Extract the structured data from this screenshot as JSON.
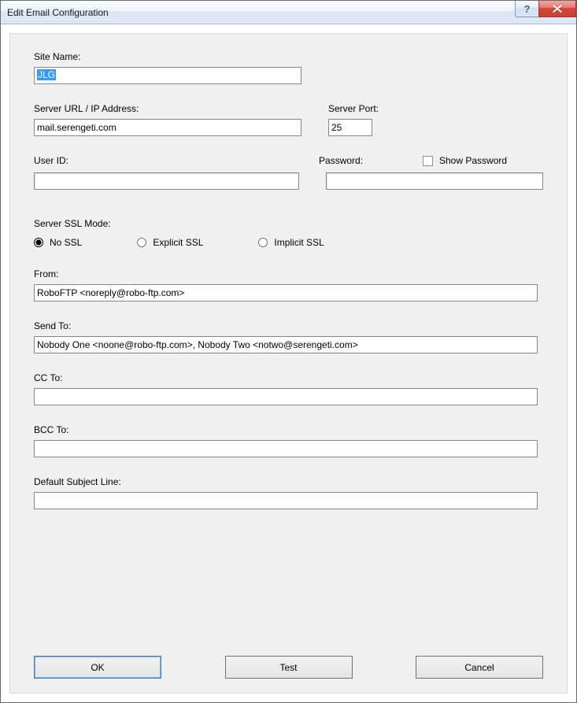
{
  "titlebar": {
    "title": "Edit Email Configuration"
  },
  "fields": {
    "site_name": {
      "label": "Site Name:",
      "value": "JLG"
    },
    "server_url": {
      "label": "Server URL / IP Address:",
      "value": "mail.serengeti.com"
    },
    "server_port": {
      "label": "Server Port:",
      "value": "25"
    },
    "user_id": {
      "label": "User ID:",
      "value": ""
    },
    "password": {
      "label": "Password:",
      "value": ""
    },
    "show_password": {
      "label": "Show Password",
      "checked": false
    },
    "ssl_mode": {
      "label": "Server SSL Mode:",
      "options": {
        "none": "No SSL",
        "explicit": "Explicit SSL",
        "implicit": "Implicit SSL"
      },
      "selected": "none"
    },
    "from": {
      "label": "From:",
      "value": "RoboFTP <noreply@robo-ftp.com>"
    },
    "send_to": {
      "label": "Send To:",
      "value": "Nobody One <noone@robo-ftp.com>, Nobody Two <notwo@serengeti.com>"
    },
    "cc_to": {
      "label": "CC To:",
      "value": ""
    },
    "bcc_to": {
      "label": "BCC To:",
      "value": ""
    },
    "subject": {
      "label": "Default Subject Line:",
      "value": ""
    }
  },
  "buttons": {
    "ok": "OK",
    "test": "Test",
    "cancel": "Cancel"
  }
}
